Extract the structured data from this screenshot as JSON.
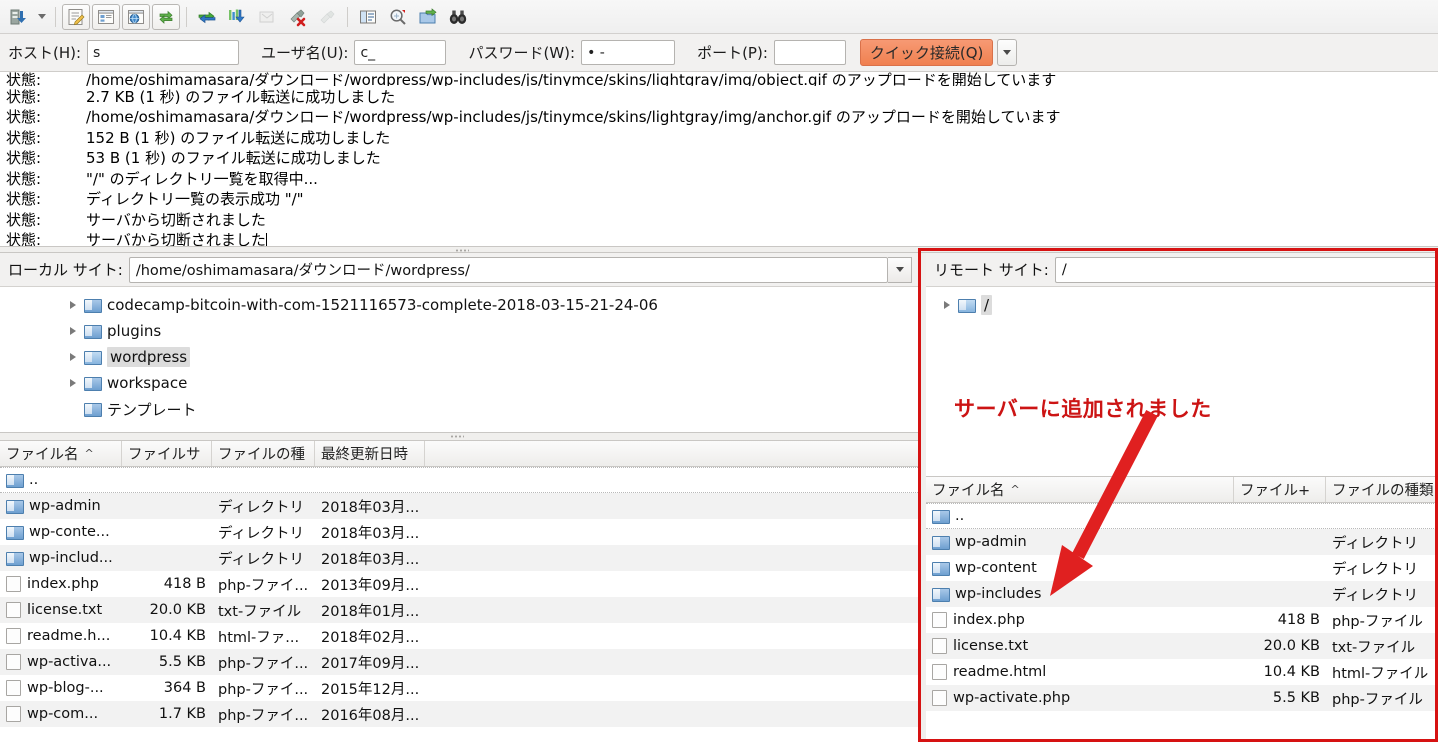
{
  "toolbar": {
    "icons": [
      {
        "name": "site-manager-icon",
        "label": "サイトマネージャー"
      },
      {
        "name": "site-manager-dropdown-icon",
        "label": "サイトマネージャーのドロップダウン"
      },
      {
        "name": "toggle-message-log-icon",
        "label": "メッセージログの切り替え"
      },
      {
        "name": "toggle-local-tree-icon",
        "label": "ローカルツリーの切り替え"
      },
      {
        "name": "toggle-remote-tree-icon",
        "label": "リモートツリーの切り替え"
      },
      {
        "name": "toggle-transfer-queue-icon",
        "label": "転送キューの切り替え"
      },
      {
        "name": "refresh-icon",
        "label": "更新"
      },
      {
        "name": "process-queue-icon",
        "label": "キューの処理"
      },
      {
        "name": "cancel-operation-icon",
        "label": "操作の取り消し"
      },
      {
        "name": "disconnect-icon",
        "label": "切断"
      },
      {
        "name": "reconnect-icon",
        "label": "再接続"
      },
      {
        "name": "filter-icon",
        "label": "ファイル名フィルタ"
      },
      {
        "name": "compare-directories-icon",
        "label": "ディレクトリの比較"
      },
      {
        "name": "synchronized-browsing-icon",
        "label": "同期ブラウジング"
      },
      {
        "name": "find-files-icon",
        "label": "リモートファイルの検索"
      }
    ]
  },
  "connection_bar": {
    "host_label": "ホスト(H):",
    "host_value": "s",
    "user_label": "ユーザ名(U):",
    "user_value": "c_",
    "password_label": "パスワード(W):",
    "password_value": "• -",
    "port_label": "ポート(P):",
    "port_value": "",
    "quickconnect_label": "クイック接続(Q)",
    "quickconnect_color": "#f08050",
    "dropdown_icon": "chevron-down-icon"
  },
  "log": {
    "key": "状態:",
    "rows": [
      {
        "key": "状態:",
        "value": "/home/oshimamasara/ダウンロード/wordpress/wp-includes/js/tinymce/skins/lightgray/img/object.gif のアップロードを開始しています"
      },
      {
        "key": "状態:",
        "value": "2.7 KB (1 秒) のファイル転送に成功しました"
      },
      {
        "key": "状態:",
        "value": "/home/oshimamasara/ダウンロード/wordpress/wp-includes/js/tinymce/skins/lightgray/img/anchor.gif のアップロードを開始しています"
      },
      {
        "key": "状態:",
        "value": "152 B (1 秒) のファイル転送に成功しました"
      },
      {
        "key": "状態:",
        "value": "53 B (1 秒) のファイル転送に成功しました"
      },
      {
        "key": "状態:",
        "value": "\"/\" のディレクトリ一覧を取得中..."
      },
      {
        "key": "状態:",
        "value": "ディレクトリ一覧の表示成功 \"/\""
      },
      {
        "key": "状態:",
        "value": "サーバから切断されました"
      },
      {
        "key": "状態:",
        "value": "サーバから切断されました"
      }
    ]
  },
  "local": {
    "path_label": "ローカル サイト:",
    "path_value": "/home/oshimamasara/ダウンロード/wordpress/",
    "tree": [
      {
        "label": "codecamp-bitcoin-with-com-1521116573-complete-2018-03-15-21-24-06",
        "expandable": true,
        "selected": false,
        "opened": false
      },
      {
        "label": "plugins",
        "expandable": true,
        "selected": false,
        "opened": false
      },
      {
        "label": "wordpress",
        "expandable": true,
        "selected": true,
        "opened": true
      },
      {
        "label": "workspace",
        "expandable": true,
        "selected": false,
        "opened": false
      },
      {
        "label": "テンプレート",
        "expandable": false,
        "selected": false,
        "opened": false
      }
    ],
    "columns": [
      "ファイル名",
      "ファイルサ",
      "ファイルの種",
      "最終更新日時"
    ],
    "sort_indicator": "^",
    "rows": [
      {
        "name": "..",
        "size": "",
        "type": "",
        "modified": "",
        "kind": "dir"
      },
      {
        "name": "wp-admin",
        "size": "",
        "type": "ディレクトリ",
        "modified": "2018年03月...",
        "kind": "dir"
      },
      {
        "name": "wp-conte...",
        "size": "",
        "type": "ディレクトリ",
        "modified": "2018年03月...",
        "kind": "dir"
      },
      {
        "name": "wp-includ...",
        "size": "",
        "type": "ディレクトリ",
        "modified": "2018年03月...",
        "kind": "dir"
      },
      {
        "name": "index.php",
        "size": "418 B",
        "type": "php-ファイ...",
        "modified": "2013年09月...",
        "kind": "file"
      },
      {
        "name": "license.txt",
        "size": "20.0 KB",
        "type": "txt-ファイル",
        "modified": "2018年01月...",
        "kind": "file"
      },
      {
        "name": "readme.h...",
        "size": "10.4 KB",
        "type": "html-ファ...",
        "modified": "2018年02月...",
        "kind": "file"
      },
      {
        "name": "wp-activa...",
        "size": "5.5 KB",
        "type": "php-ファイ...",
        "modified": "2017年09月...",
        "kind": "file"
      },
      {
        "name": "wp-blog-...",
        "size": "364 B",
        "type": "php-ファイ...",
        "modified": "2015年12月...",
        "kind": "file"
      },
      {
        "name": "wp-com...",
        "size": "1.7 KB",
        "type": "php-ファイ...",
        "modified": "2016年08月...",
        "kind": "file"
      }
    ]
  },
  "remote": {
    "path_label": "リモート サイト:",
    "path_value": "/",
    "tree": [
      {
        "label": "/",
        "expandable": true,
        "selected": true,
        "opened": true
      }
    ],
    "annotation": "サーバーに追加されました",
    "annotation_color": "#cc1414",
    "highlight_color": "#d61212",
    "columns": [
      "ファイル名",
      "ファイル+",
      "ファイルの種類"
    ],
    "sort_indicator": "^",
    "rows": [
      {
        "name": "..",
        "size": "",
        "type": "",
        "kind": "dir"
      },
      {
        "name": "wp-admin",
        "size": "",
        "type": "ディレクトリ",
        "kind": "dir"
      },
      {
        "name": "wp-content",
        "size": "",
        "type": "ディレクトリ",
        "kind": "dir"
      },
      {
        "name": "wp-includes",
        "size": "",
        "type": "ディレクトリ",
        "kind": "dir"
      },
      {
        "name": "index.php",
        "size": "418 B",
        "type": "php-ファイル",
        "kind": "file"
      },
      {
        "name": "license.txt",
        "size": "20.0 KB",
        "type": "txt-ファイル",
        "kind": "file"
      },
      {
        "name": "readme.html",
        "size": "10.4 KB",
        "type": "html-ファイル",
        "kind": "file"
      },
      {
        "name": "wp-activate.php",
        "size": "5.5 KB",
        "type": "php-ファイル",
        "kind": "file"
      }
    ]
  }
}
